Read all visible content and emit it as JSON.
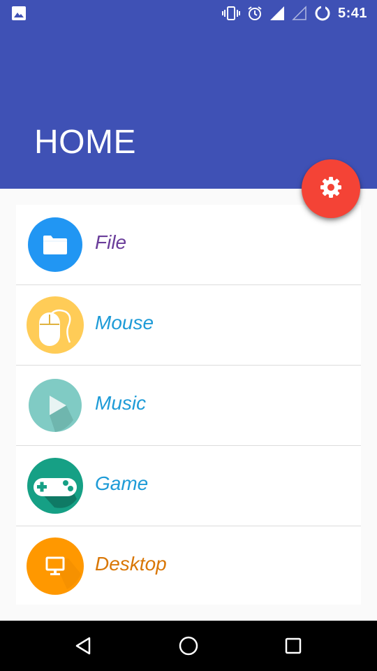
{
  "status_bar": {
    "time": "5:41",
    "left_icon": "image-icon",
    "icons": [
      "vibrate-icon",
      "alarm-icon",
      "signal-full-icon",
      "signal-empty-icon",
      "sync-icon"
    ]
  },
  "app_bar": {
    "title": "HOME",
    "color": "#3f51b5"
  },
  "fab": {
    "icon": "gear-icon",
    "color": "#f44336"
  },
  "menu": {
    "items": [
      {
        "label": "File",
        "icon": "folder-icon",
        "color": "#6a3d9a",
        "icon_color": "#2196f3"
      },
      {
        "label": "Mouse",
        "icon": "mouse-icon",
        "color": "#1e9bd7",
        "icon_color": "#ffcc57"
      },
      {
        "label": "Music",
        "icon": "play-icon",
        "color": "#1e9bd7",
        "icon_color": "#80cbc4"
      },
      {
        "label": "Game",
        "icon": "gamepad-icon",
        "color": "#1e9bd7",
        "icon_color": "#16a085"
      },
      {
        "label": "Desktop",
        "icon": "monitor-icon",
        "color": "#d97706",
        "icon_color": "#ff9800"
      }
    ]
  },
  "nav_bar": {
    "buttons": [
      "back-icon",
      "home-icon",
      "recents-icon"
    ]
  }
}
